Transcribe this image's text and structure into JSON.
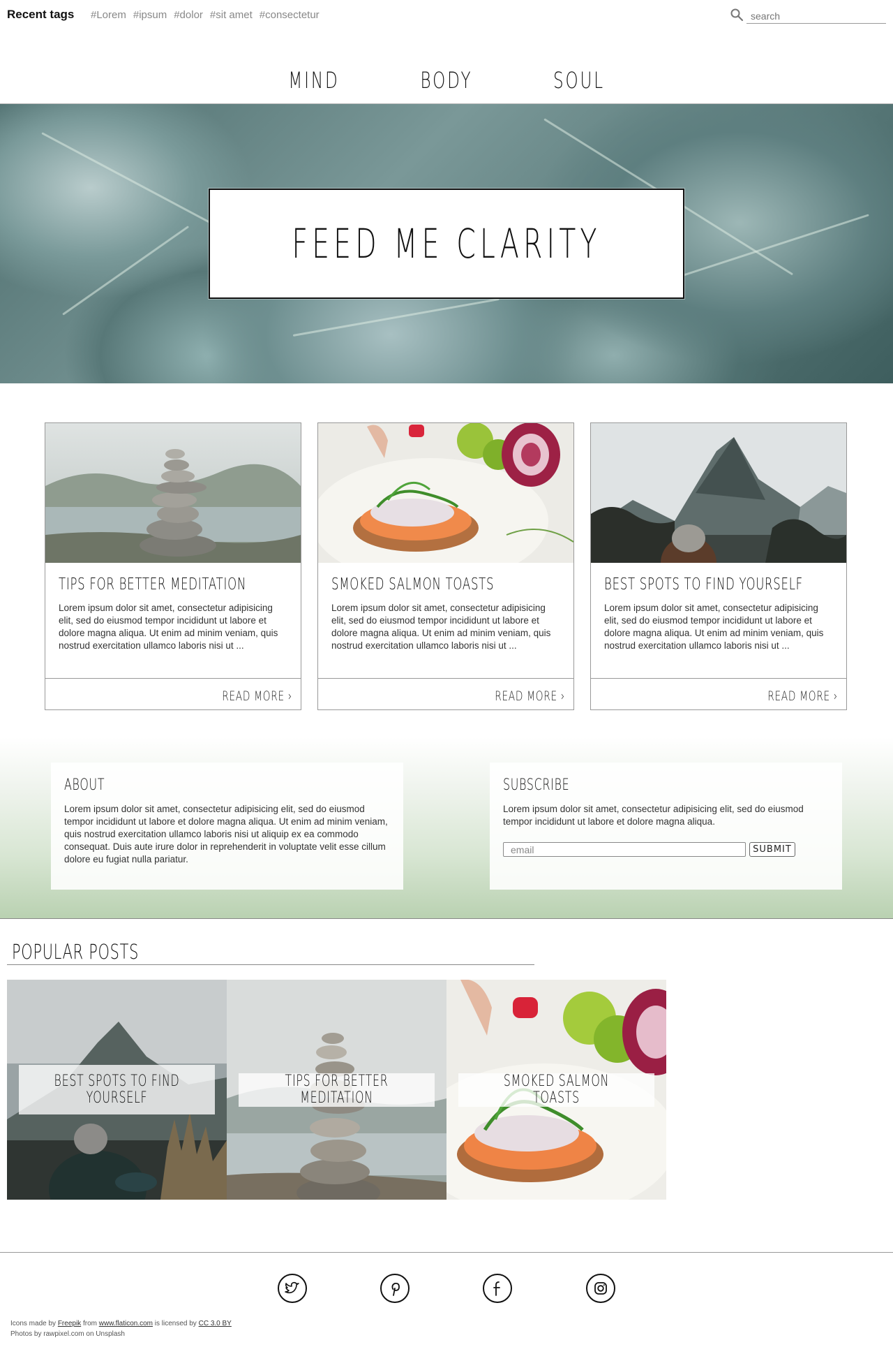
{
  "topbar": {
    "recent_tags_label": "Recent tags",
    "tags": [
      "#Lorem",
      "#ipsum",
      "#dolor",
      "#sit amet",
      "#consectetur"
    ],
    "search_placeholder": "search"
  },
  "nav": {
    "items": [
      "MIND",
      "BODY",
      "SOUL"
    ]
  },
  "hero": {
    "title": "FEED ME CLARITY"
  },
  "cards": [
    {
      "title": "TIPS FOR BETTER MEDITATION",
      "body": "Lorem ipsum dolor sit amet, consectetur adipisicing elit, sed do eiusmod tempor incididunt ut labore et dolore magna aliqua. Ut enim ad minim veniam, quis nostrud exercitation ullamco laboris nisi ut ...",
      "read_more": "READ MORE ›"
    },
    {
      "title": "SMOKED SALMON TOASTS",
      "body": "Lorem ipsum dolor sit amet, consectetur adipisicing elit, sed do eiusmod tempor incididunt ut labore et dolore magna aliqua. Ut enim ad minim veniam, quis nostrud exercitation ullamco laboris nisi ut ...",
      "read_more": "READ MORE ›"
    },
    {
      "title": "BEST SPOTS TO FIND YOURSELF",
      "body": "Lorem ipsum dolor sit amet, consectetur adipisicing elit, sed do eiusmod tempor incididunt ut labore et dolore magna aliqua. Ut enim ad minim veniam, quis nostrud exercitation ullamco laboris nisi ut ...",
      "read_more": "READ MORE ›"
    }
  ],
  "about": {
    "title": "ABOUT",
    "body": "Lorem ipsum dolor sit amet, consectetur adipisicing elit, sed do eiusmod tempor incididunt ut labore et dolore magna aliqua. Ut enim ad minim veniam, quis nostrud exercitation ullamco laboris nisi ut aliquip ex ea commodo consequat. Duis aute irure dolor in reprehenderit in voluptate velit esse cillum dolore eu fugiat nulla pariatur."
  },
  "subscribe": {
    "title": "SUBSCRIBE",
    "body": "Lorem ipsum dolor sit amet, consectetur adipisicing elit, sed do eiusmod tempor incididunt ut labore et dolore magna aliqua.",
    "email_placeholder": "email",
    "submit_label": "SUBMIT"
  },
  "popular": {
    "title": "POPULAR POSTS",
    "posts": [
      "BEST SPOTS TO FIND YOURSELF",
      "TIPS FOR BETTER MEDITATION",
      "SMOKED SALMON TOASTS"
    ]
  },
  "footer": {
    "social_icons": [
      "twitter-icon",
      "pinterest-icon",
      "facebook-icon",
      "instagram-icon"
    ],
    "credits": {
      "line1_prefix": "Icons made by",
      "freepik": "Freepik",
      "from": "from",
      "flaticon": "www.flaticon.com",
      "licensed": "is licensed by",
      "cc": "CC 3.0 BY",
      "line2": "Photos by rawpixel.com on Unsplash"
    }
  }
}
